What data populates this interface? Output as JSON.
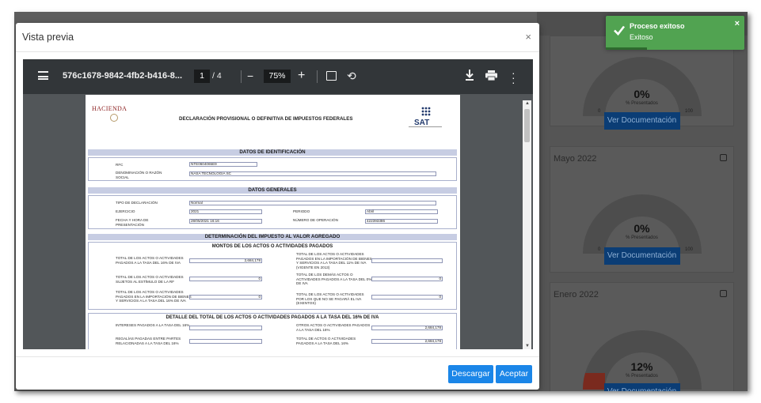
{
  "background": {
    "cards": [
      {
        "month": "",
        "gauge_value": "0%",
        "gauge_sub": "% Presentados",
        "tick_min": "0",
        "tick_max": "100",
        "button": "Ver Documentación"
      },
      {
        "month": "Mayo 2022",
        "gauge_value": "0%",
        "gauge_sub": "% Presentados",
        "tick_min": "0",
        "tick_max": "100",
        "button": "Ver Documentación"
      },
      {
        "month": "Enero 2022",
        "gauge_value": "12%",
        "gauge_sub": "% Presentados",
        "tick_min": "0",
        "tick_max": "100",
        "button": "Ver Documentación"
      }
    ]
  },
  "toast": {
    "title": "Proceso exitoso",
    "message": "Exitoso",
    "close": "×"
  },
  "modal": {
    "title": "Vista previa",
    "close": "×",
    "footer": {
      "download_label": "Descargar",
      "accept_label": "Aceptar"
    }
  },
  "viewer": {
    "file_title": "576c1678-9842-4fb2-b416-8...",
    "page_current": "1",
    "page_count": "/ 4",
    "zoom": "75%"
  },
  "document": {
    "logo_text": "HACIENDA",
    "sat_text": "SAT",
    "header": "DECLARACIÓN PROVISIONAL O DEFINITIVA DE IMPUESTOS FEDERALES",
    "sections": {
      "identificacion": "DATOS DE IDENTIFICACIÓN",
      "generales": "DATOS GENERALES",
      "iva": "DETERMINACIÓN DEL IMPUESTO AL VALOR AGREGADO",
      "montos": "MONTOS DE LOS ACTOS O ACTIVIDADES PAGADOS",
      "detalle": "DETALLE DEL TOTAL DE LOS ACTOS O ACTIVIDADES PAGADOS A LA TASA DEL 16% DE IVA"
    },
    "identificacion": {
      "rfc_label": "RFC",
      "rfc_value": "NTE0604065E9",
      "razon_label": "DENOMINACIÓN O RAZÓN SOCIAL",
      "razon_value": "NASA TECNOLOGIA SC"
    },
    "generales": {
      "tipo_label": "TIPO DE DECLARACIÓN",
      "tipo_value": "Normal",
      "ejercicio_label": "EJERCICIO",
      "ejercicio_value": "2021",
      "periodo_label": "PERIODO",
      "periodo_value": "Abril",
      "fecha_label": "FECHA Y HORA DE PRESENTACIÓN",
      "fecha_value": "28/05/2021 16:16",
      "operacion_label": "NÚMERO DE OPERACIÓN",
      "operacion_value": "422393386"
    },
    "montos": {
      "l1": "TOTAL DE LOS ACTOS O ACTIVIDADES PAGADOS A LA TASA DEL 16% DE IVA",
      "v1": "2,684,178",
      "r1": "TOTAL DE LOS ACTOS O ACTIVIDADES PAGADOS EN LA IMPORTACIÓN DE BIENES Y SERVICIOS A LA TASA DEL 11% DE IVA (VIGENTE EN 2013)",
      "rv1": "",
      "l2": "TOTAL DE LOS ACTOS O ACTIVIDADES SUJETOS AL ESTÍMULO DE LA RF",
      "v2": "0",
      "r2": "TOTAL DE LOS DEMÁS ACTOS O ACTIVIDADES PAGADOS A LA TASA DEL 0% DE IVA",
      "rv2": "0",
      "l3": "TOTAL DE LOS ACTOS O ACTIVIDADES PAGADOS EN LA IMPORTACIÓN DE BIENES Y SERVICIOS A LA TASA DEL 16% DE IVA",
      "v3": "0",
      "r3": "TOTAL DE LOS ACTOS O ACTIVIDADES POR LOS QUE NO SE PAGARÁ EL IVA (EXENTOS)",
      "rv3": "0"
    },
    "detalle": {
      "l1": "INTERESES PAGADOS A LA TASA DEL 16%",
      "v1": "",
      "r1": "OTROS ACTOS O ACTIVIDADES PAGADOS A LA TASA DEL 16%",
      "rv1": "2,684,178",
      "l2": "REGALÍAS PAGADAS ENTRE PARTES RELACIONADAS A LA TASA DEL 16%",
      "v2": "",
      "r2": "TOTAL DE ACTOS O ACTIVIDADES PAGADOS A LA TASA DEL 16%",
      "rv2": "2,684,178"
    }
  },
  "colors": {
    "toast": "#51a351",
    "primary_button": "#1b86e8",
    "viewer_toolbar": "#323639",
    "viewer_bg": "#525659"
  }
}
